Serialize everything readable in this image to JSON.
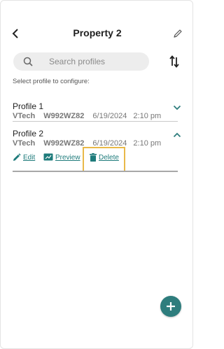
{
  "header": {
    "title": "Property 2"
  },
  "search": {
    "placeholder": "Search profiles"
  },
  "instruction": "Select profile to configure:",
  "profiles": [
    {
      "name": "Profile 1",
      "brand": "VTech",
      "model": "W992WZ82",
      "date": "6/19/2024",
      "time": "2:10 pm",
      "expanded": false
    },
    {
      "name": "Profile 2",
      "brand": "VTech",
      "model": "W992WZ82",
      "date": "6/19/2024",
      "time": "2:10 pm",
      "expanded": true
    }
  ],
  "actions": {
    "edit": "Edit",
    "preview": "Preview",
    "delete": "Delete"
  },
  "colors": {
    "accent": "#2e7d7d",
    "link": "#1e7b7b",
    "highlight": "#e9b949",
    "search_bg": "#ededed"
  },
  "icons": {
    "back": "arrow-left-icon",
    "edit_title": "pencil-icon",
    "search": "search-icon",
    "sort": "sort-icon",
    "expand": "chevron-down-icon",
    "collapse": "chevron-up-icon",
    "edit": "pencil-icon",
    "preview": "preview-icon",
    "delete": "trash-icon",
    "add": "plus-icon"
  }
}
